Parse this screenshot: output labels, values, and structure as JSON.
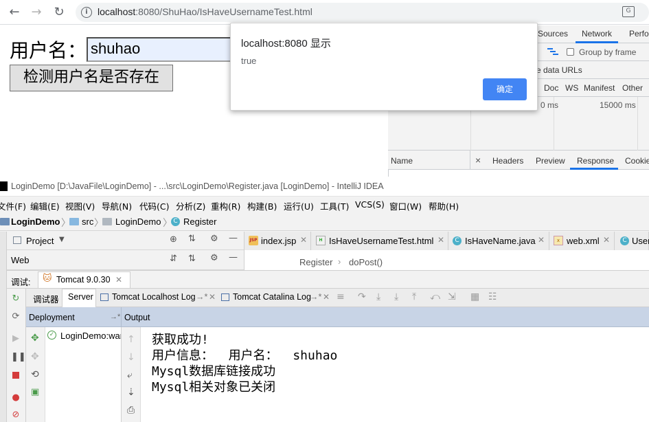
{
  "browser": {
    "back": "←",
    "forward": "→",
    "reload": "↻",
    "url_host": "localhost",
    "url_rest": ":8080/ShuHao/IsHaveUsernameTest.html",
    "info_glyph": "i",
    "translate_glyph": "G"
  },
  "page": {
    "username_label": "用户名：",
    "username_value": "shuhao",
    "check_button": "检测用户名是否存在"
  },
  "alert": {
    "title": "localhost:8080 显示",
    "message": "true",
    "ok": "确定"
  },
  "devtools": {
    "tabs": {
      "sources": "Sources",
      "network": "Network",
      "perf": "Perfo"
    },
    "group_by_frame": "Group by frame",
    "hide_data_urls": "e data URLs",
    "filters": [
      "Doc",
      "WS",
      "Manifest",
      "Other"
    ],
    "timeline": {
      "t1": "0 ms",
      "t2": "15000 ms"
    },
    "name_col": "Name",
    "close_glyph": "×",
    "detail_tabs": [
      "Headers",
      "Preview",
      "Response",
      "Cookie"
    ]
  },
  "intellij": {
    "title": "LoginDemo [D:\\JavaFile\\LoginDemo] - ...\\src\\LoginDemo\\Register.java [LoginDemo] - IntelliJ IDEA",
    "menu": [
      "文件(F)",
      "编辑(E)",
      "视图(V)",
      "导航(N)",
      "代码(C)",
      "分析(Z)",
      "重构(R)",
      "构建(B)",
      "运行(U)",
      "工具(T)",
      "VCS(S)",
      "窗口(W)",
      "帮助(H)"
    ],
    "breadcrumb": {
      "project": "LoginDemo",
      "src": "src",
      "pkg": "LoginDemo",
      "cls": "Register"
    },
    "project_panel": "Project",
    "web_row": "Web",
    "editor_tabs": [
      "index.jsp",
      "IsHaveUsernameTest.html",
      "IsHaveName.java",
      "web.xml",
      "User"
    ],
    "editor_crumb": {
      "cls": "Register",
      "method": "doPost()"
    },
    "debug_label": "调试:",
    "debug_config": "Tomcat 9.0.30",
    "server_tabs": {
      "debugger": "调试器",
      "server": "Server",
      "localhost_log": "Tomcat Localhost Log",
      "catalina_log": "Tomcat Catalina Log"
    },
    "deployment_head": "Deployment",
    "output_head": "Output",
    "deploy_item": "LoginDemo:war",
    "output_lines": [
      "获取成功!",
      "用户信息：  用户名：  shuhao",
      "Mysql数据库链接成功",
      "Mysql相关对象已关闭"
    ]
  },
  "colors": {
    "accent": "#1a73e8",
    "alert_ok": "#4285f4",
    "ij_header": "#c8d4e6"
  }
}
